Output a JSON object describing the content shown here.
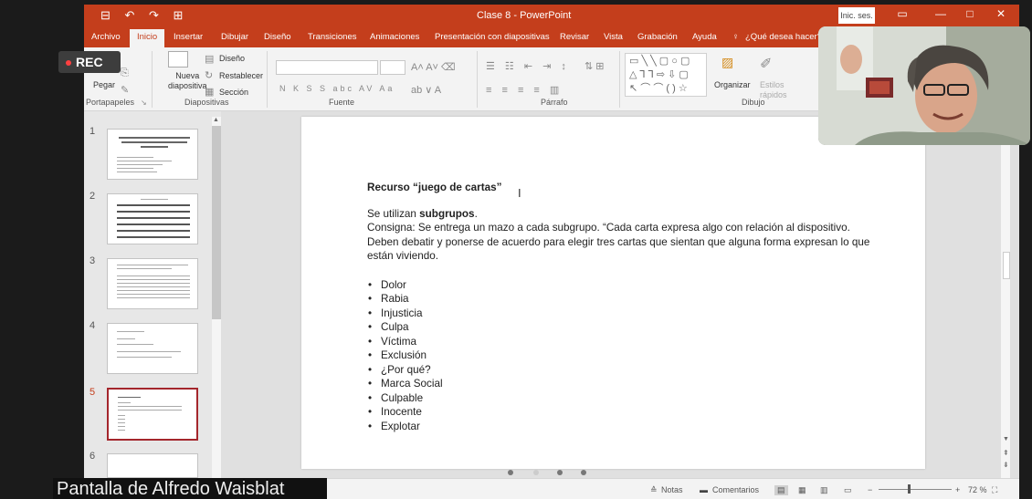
{
  "app": {
    "title": "Clase 8 - PowerPoint",
    "signin": "Inic. ses.",
    "quick_access": "⊟ ↶ ↷ ⊞"
  },
  "tabs": [
    "Archivo",
    "Inicio",
    "Insertar",
    "Dibujar",
    "Diseño",
    "Transiciones",
    "Animaciones",
    "Presentación con diapositivas",
    "Revisar",
    "Vista",
    "Grabación",
    "Ayuda",
    "¿Qué desea hacer?"
  ],
  "ribbon": {
    "clipboard": {
      "paste": "Pegar",
      "group": "Portapapeles"
    },
    "slides": {
      "new_slide": "Nueva\ndiapositiva",
      "layout": "Diseño",
      "reset": "Restablecer",
      "section": "Sección",
      "group": "Diapositivas"
    },
    "font": {
      "group": "Fuente",
      "format_row": "N K S S abc AV Aa"
    },
    "paragraph": {
      "group": "Párrafo"
    },
    "drawing": {
      "arrange": "Organizar",
      "quick_styles": "Estilos rápidos",
      "group": "Dibujo"
    }
  },
  "thumbnails": [
    {
      "num": "1"
    },
    {
      "num": "2"
    },
    {
      "num": "3"
    },
    {
      "num": "4"
    },
    {
      "num": "5"
    },
    {
      "num": "6"
    }
  ],
  "slide": {
    "title": "Recurso “juego de cartas”",
    "intro_prefix": "Se utilizan ",
    "intro_bold": "subgrupos",
    "intro_suffix": ".",
    "consigna": "Consigna: Se entrega un mazo a cada subgrupo. “Cada carta expresa algo con relación al dispositivo. Deben debatir y ponerse de acuerdo para elegir tres cartas que sientan que alguna forma expresan lo que están viviendo.",
    "bullets": [
      "Dolor",
      "Rabia",
      "Injusticia",
      "Culpa",
      "Víctima",
      "Exclusión",
      "¿Por qué?",
      "Marca Social",
      "Culpable",
      "Inocente",
      "Explotar"
    ]
  },
  "status": {
    "notes": "Notas",
    "comments": "Comentarios",
    "zoom": "72 %"
  },
  "overlay": {
    "rec": "REC",
    "caption": "Pantalla de Alfredo Waisblat"
  },
  "colors": {
    "accent": "#c43e1c",
    "selected_thumb": "#a4262c"
  }
}
